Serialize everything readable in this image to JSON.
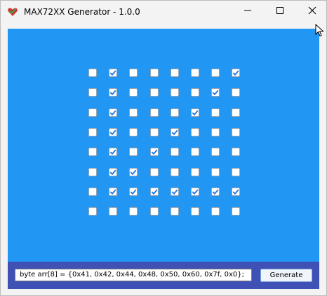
{
  "window": {
    "title": "MAX72XX Generator - 1.0.0",
    "controls": [
      "minimize",
      "maximize",
      "close"
    ]
  },
  "icons": {
    "app": "heart-icon",
    "minimize": "minimize-icon",
    "maximize": "maximize-icon",
    "close": "close-icon",
    "cursor": "mouse-cursor-icon"
  },
  "colors": {
    "canvas": "#2196f3",
    "bottom_bar": "#3f51b5",
    "check": "#1a73e8"
  },
  "matrix": {
    "rows": 8,
    "cols": 8,
    "cells": [
      [
        0,
        1,
        0,
        0,
        0,
        0,
        0,
        1
      ],
      [
        0,
        1,
        0,
        0,
        0,
        0,
        1,
        0
      ],
      [
        0,
        1,
        0,
        0,
        0,
        1,
        0,
        0
      ],
      [
        0,
        1,
        0,
        0,
        1,
        0,
        0,
        0
      ],
      [
        0,
        1,
        0,
        1,
        0,
        0,
        0,
        0
      ],
      [
        0,
        1,
        1,
        0,
        0,
        0,
        0,
        0
      ],
      [
        0,
        1,
        1,
        1,
        1,
        1,
        1,
        1
      ],
      [
        0,
        0,
        0,
        0,
        0,
        0,
        0,
        0
      ]
    ]
  },
  "output": {
    "code": "byte arr[8] = {0x41, 0x42, 0x44, 0x48, 0x50, 0x60, 0x7f, 0x0};",
    "generate_label": "Generate"
  }
}
